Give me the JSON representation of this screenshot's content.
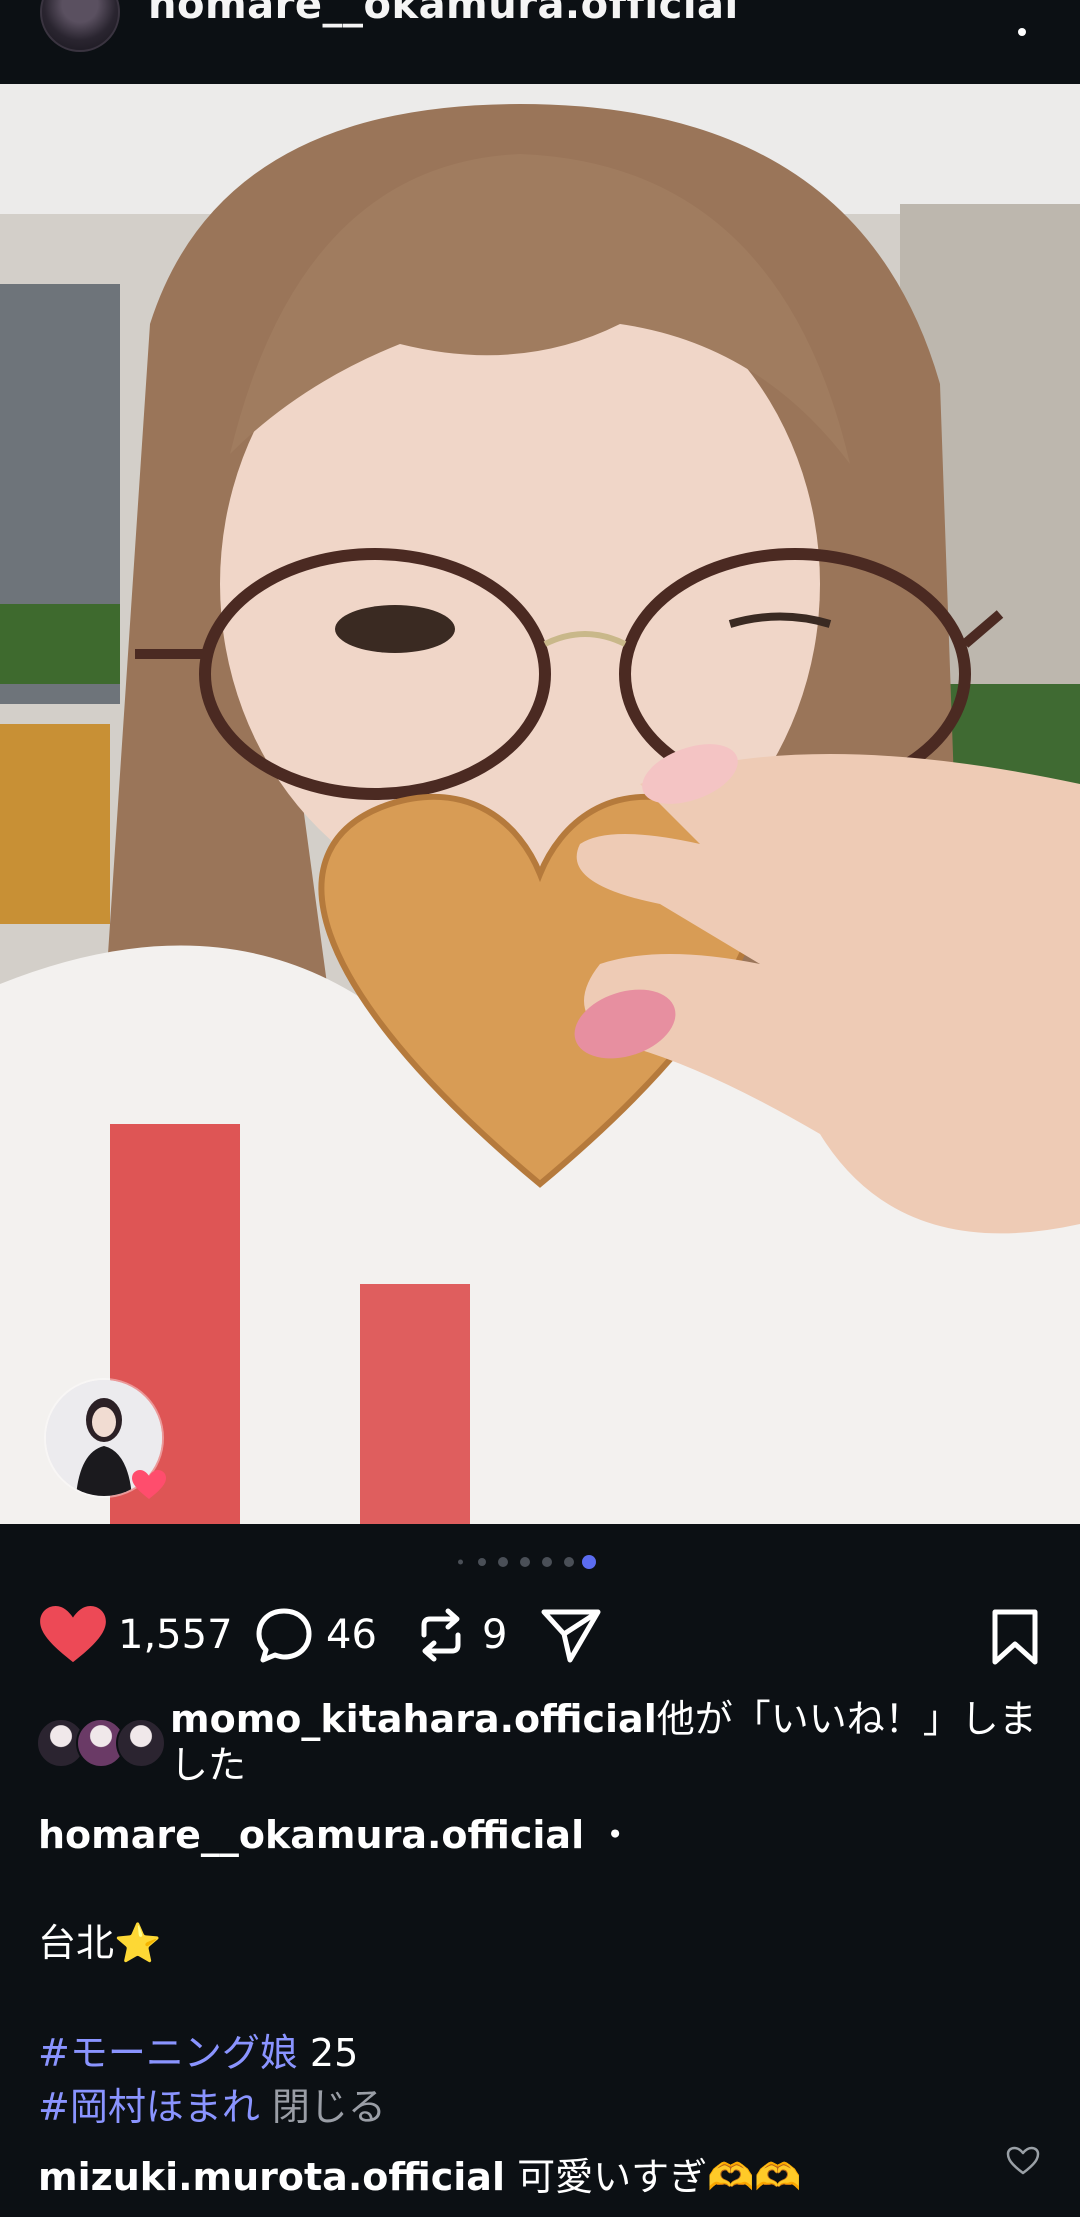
{
  "header": {
    "username": "homare__okamura.official",
    "avatar_icon": "profile-avatar-icon",
    "more_icon": "more-options-icon"
  },
  "post": {
    "image_description_icon": "photo-post-image",
    "carousel": {
      "total": 7,
      "active_index": 6
    }
  },
  "actions": {
    "like_count": "1,557",
    "comment_count": "46",
    "repost_count": "9",
    "like_color": "#ed4956",
    "icons": [
      "heart-icon",
      "comment-icon",
      "repost-icon",
      "share-icon",
      "bookmark-icon"
    ]
  },
  "liked_by": {
    "user": "momo_kitahara.official",
    "suffix": "他が「いいね！」しました"
  },
  "caption": {
    "user": "homare__okamura.official",
    "separator": "・",
    "line1": "台北⭐️",
    "tag1": "#モーニング娘",
    "tag1_suffix": " 25",
    "tag2": "#岡村ほまれ",
    "close_label": "閉じる"
  },
  "comment": {
    "user": "mizuki.murota.official",
    "text": "可愛いすぎ🫶🫶"
  },
  "colors": {
    "background": "#0c1014",
    "hashtag": "#8a94ff",
    "active_dot": "#5b6cf0"
  }
}
